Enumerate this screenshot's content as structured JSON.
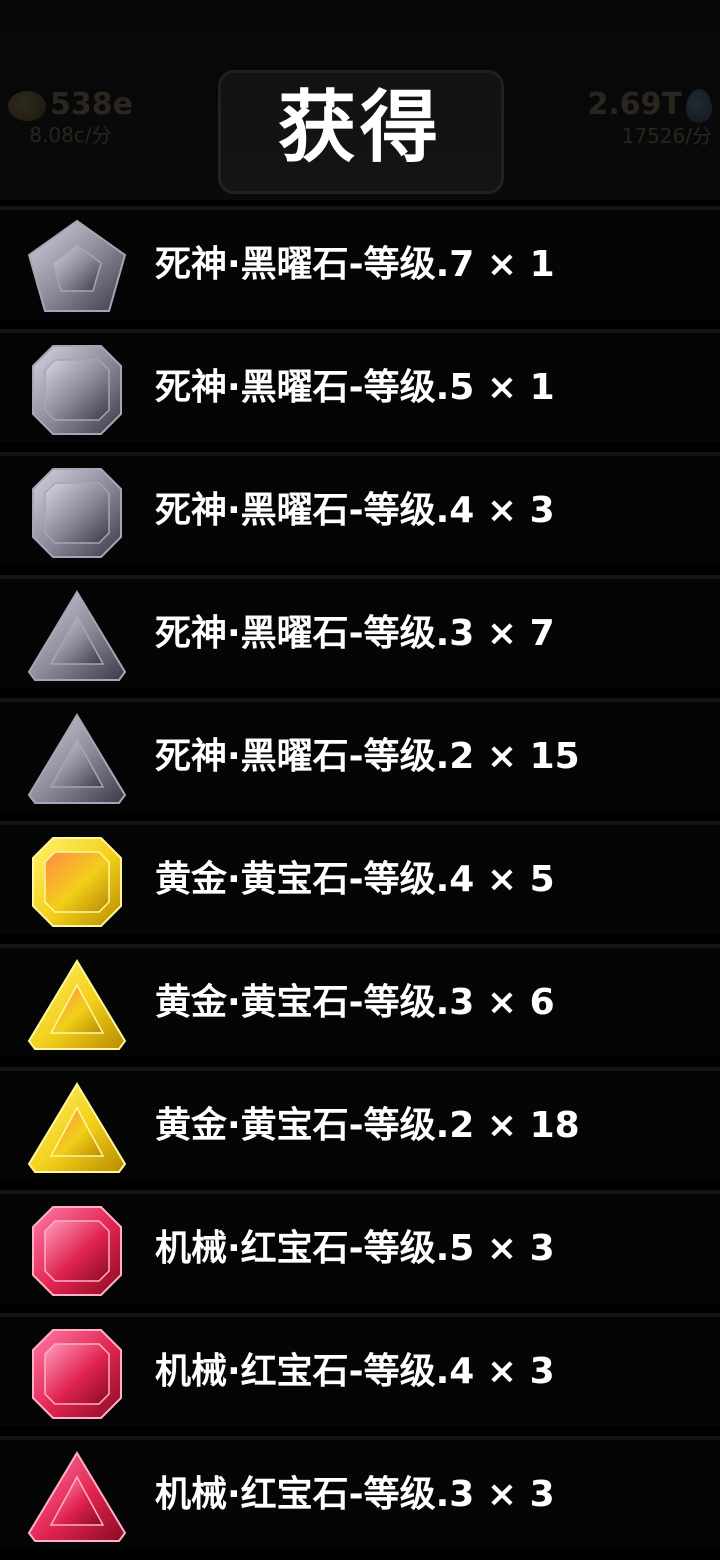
{
  "title": "获得",
  "background_hud": {
    "left": {
      "value": "538e",
      "rate": "8.08c/分",
      "icon": "coin-icon"
    },
    "right": {
      "value": "2.69T",
      "rate": "17526/分",
      "icon": "crystal-icon"
    }
  },
  "items": [
    {
      "label": "死神·黑曜石-等级.7 × 1",
      "gem": "pentagon",
      "color": "dark"
    },
    {
      "label": "死神·黑曜石-等级.5 × 1",
      "gem": "octagon",
      "color": "dark"
    },
    {
      "label": "死神·黑曜石-等级.4 × 3",
      "gem": "octagon",
      "color": "dark"
    },
    {
      "label": "死神·黑曜石-等级.3 × 7",
      "gem": "triangle",
      "color": "dark"
    },
    {
      "label": "死神·黑曜石-等级.2 × 15",
      "gem": "triangle",
      "color": "dark"
    },
    {
      "label": "黄金·黄宝石-等级.4 × 5",
      "gem": "octagon",
      "color": "yellow"
    },
    {
      "label": "黄金·黄宝石-等级.3 × 6",
      "gem": "triangle",
      "color": "yellow"
    },
    {
      "label": "黄金·黄宝石-等级.2 × 18",
      "gem": "triangle",
      "color": "yellow"
    },
    {
      "label": "机械·红宝石-等级.5 × 3",
      "gem": "octagon",
      "color": "red"
    },
    {
      "label": "机械·红宝石-等级.4 × 3",
      "gem": "octagon",
      "color": "red"
    },
    {
      "label": "机械·红宝石-等级.3 × 3",
      "gem": "triangle",
      "color": "red"
    }
  ],
  "colors": {
    "dark": {
      "light": "#d7d3e3",
      "mid": "#8a8595",
      "dark": "#3c3848",
      "edge": "#a8a3b6"
    },
    "yellow": {
      "light": "#fff36a",
      "mid": "#f2cf1a",
      "dark": "#b88a00",
      "edge": "#fff7a0",
      "core": "#ff8a4a"
    },
    "red": {
      "light": "#ff7aa8",
      "mid": "#e0244f",
      "dark": "#8a0b22",
      "edge": "#ffb0c6",
      "core": "#ff9bc0"
    }
  }
}
